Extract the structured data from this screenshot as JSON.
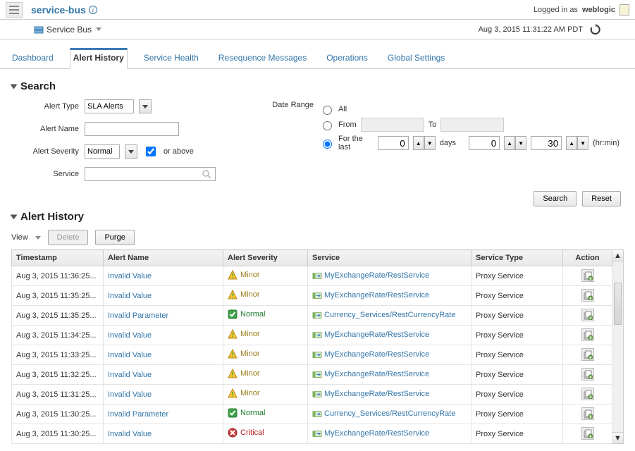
{
  "header": {
    "title": "service-bus",
    "logged_in_prefix": "Logged in as",
    "user": "weblogic"
  },
  "breadcrumb": {
    "label": "Service Bus",
    "timestamp": "Aug 3, 2015 11:31:22 AM PDT"
  },
  "tabs": [
    "Dashboard",
    "Alert History",
    "Service Health",
    "Resequence Messages",
    "Operations",
    "Global Settings"
  ],
  "active_tab": 1,
  "search": {
    "section_title": "Search",
    "alert_type_label": "Alert Type",
    "alert_type_value": "SLA Alerts",
    "alert_name_label": "Alert Name",
    "alert_name_value": "",
    "alert_severity_label": "Alert Severity",
    "alert_severity_value": "Normal",
    "or_above_label": "or above",
    "or_above_checked": true,
    "service_label": "Service",
    "service_value": "",
    "date_range_label": "Date Range",
    "radio_all": "All",
    "radio_from": "From",
    "to_label": "To",
    "radio_last": "For the last",
    "days_value": "0",
    "days_label": "days",
    "hr_value": "0",
    "min_value": "30",
    "hrmin_label": "(hr:min)",
    "selected_radio": "last",
    "search_btn": "Search",
    "reset_btn": "Reset"
  },
  "history": {
    "section_title": "Alert History",
    "view_label": "View",
    "delete_btn": "Delete",
    "purge_btn": "Purge",
    "columns": [
      "Timestamp",
      "Alert Name",
      "Alert Severity",
      "Service",
      "Service Type",
      "Action"
    ],
    "rows": [
      {
        "ts": "Aug 3, 2015 11:36:25...",
        "name": "Invalid Value",
        "sev": "Minor",
        "svc": "MyExchangeRate/RestService",
        "type": "Proxy Service"
      },
      {
        "ts": "Aug 3, 2015 11:35:25...",
        "name": "Invalid Value",
        "sev": "Minor",
        "svc": "MyExchangeRate/RestService",
        "type": "Proxy Service"
      },
      {
        "ts": "Aug 3, 2015 11:35:25...",
        "name": "Invalid Parameter",
        "sev": "Normal",
        "svc": "Currency_Services/RestCurrencyRate",
        "type": "Proxy Service"
      },
      {
        "ts": "Aug 3, 2015 11:34:25...",
        "name": "Invalid Value",
        "sev": "Minor",
        "svc": "MyExchangeRate/RestService",
        "type": "Proxy Service"
      },
      {
        "ts": "Aug 3, 2015 11:33:25...",
        "name": "Invalid Value",
        "sev": "Minor",
        "svc": "MyExchangeRate/RestService",
        "type": "Proxy Service"
      },
      {
        "ts": "Aug 3, 2015 11:32:25...",
        "name": "Invalid Value",
        "sev": "Minor",
        "svc": "MyExchangeRate/RestService",
        "type": "Proxy Service"
      },
      {
        "ts": "Aug 3, 2015 11:31:25...",
        "name": "Invalid Value",
        "sev": "Minor",
        "svc": "MyExchangeRate/RestService",
        "type": "Proxy Service"
      },
      {
        "ts": "Aug 3, 2015 11:30:25...",
        "name": "Invalid Parameter",
        "sev": "Normal",
        "svc": "Currency_Services/RestCurrencyRate",
        "type": "Proxy Service"
      },
      {
        "ts": "Aug 3, 2015 11:30:25...",
        "name": "Invalid Value",
        "sev": "Critical",
        "svc": "MyExchangeRate/RestService",
        "type": "Proxy Service"
      }
    ]
  }
}
